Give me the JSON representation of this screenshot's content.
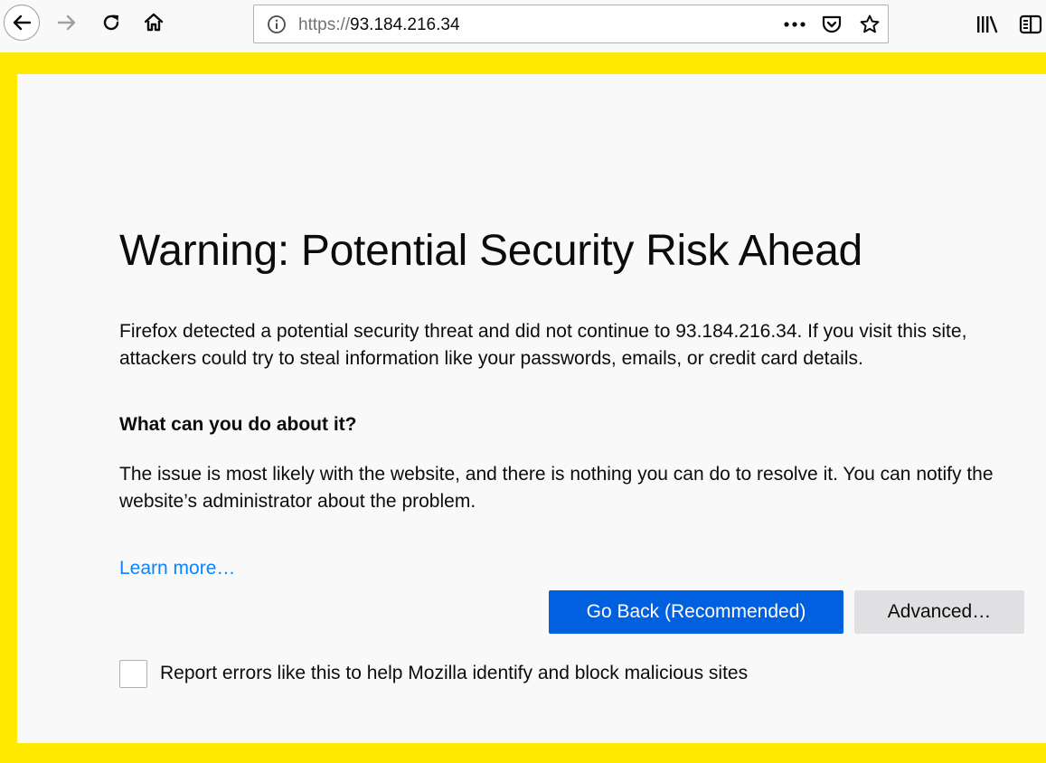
{
  "toolbar": {
    "icons": {
      "back": "back-arrow-icon",
      "forward": "forward-arrow-icon",
      "reload": "reload-icon",
      "home": "home-icon",
      "page_actions": "more-horizontal-icon",
      "pocket": "pocket-icon",
      "bookmark": "star-icon",
      "library": "library-icon",
      "sidebar": "sidebar-icon"
    }
  },
  "urlbar": {
    "scheme": "https://",
    "host": "93.184.216.34",
    "identity_icon": "info-icon"
  },
  "error_page": {
    "title": "Warning: Potential Security Risk Ahead",
    "description": "Firefox detected a potential security threat and did not continue to 93.184.216.34. If you visit this site, attackers could try to steal information like your passwords, emails, or credit card details.",
    "what_heading": "What can you do about it?",
    "what_description": "The issue is most likely with the website, and there is nothing you can do to resolve it. You can notify the website’s administrator about the problem.",
    "learn_more": "Learn more…",
    "go_back_label": "Go Back (Recommended)",
    "advanced_label": "Advanced…",
    "report_label": "Report errors like this to help Mozilla identify and block malicious sites",
    "report_checked": false
  },
  "colors": {
    "frame_border": "#ffe900",
    "page_background": "#f9f9fa",
    "primary_button": "#0060df",
    "secondary_button": "#e0e0e2",
    "link": "#0a84ff"
  }
}
